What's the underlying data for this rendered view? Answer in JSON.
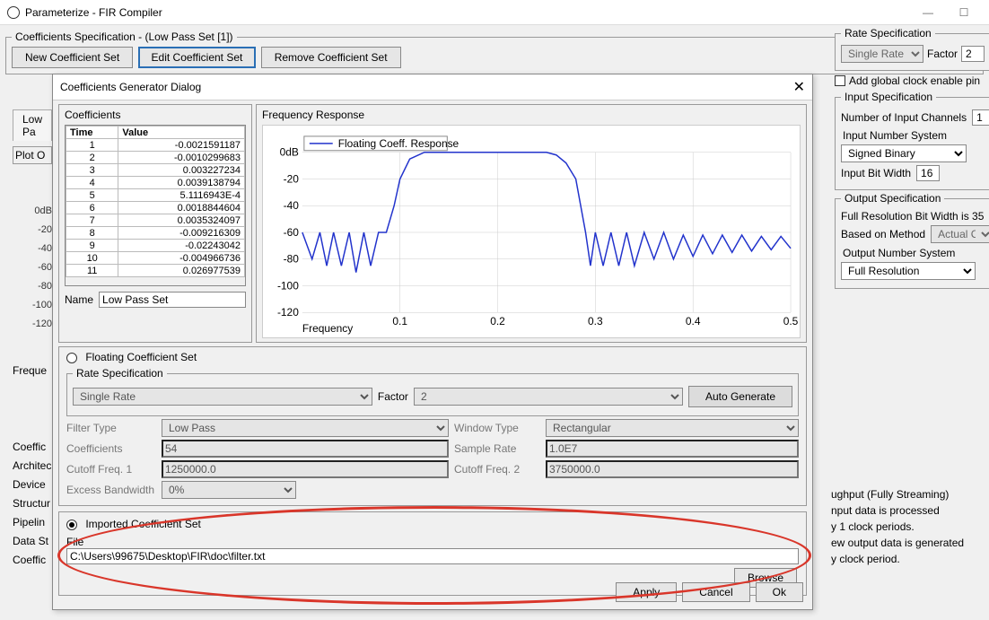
{
  "window": {
    "title": "Parameterize - FIR Compiler"
  },
  "coeffs_spec": {
    "legend": "Coefficients Specification - (Low Pass Set [1])",
    "new_btn": "New Coefficient Set",
    "edit_btn": "Edit Coefficient Set",
    "remove_btn": "Remove Coefficient Set"
  },
  "left_peek": {
    "tab": "Low Pa",
    "plot_legend": "Plot O",
    "yticks": [
      "0dB",
      "-20",
      "-40",
      "-60",
      "-80",
      "-100",
      "-120"
    ],
    "freq_label": "Freque",
    "side_list": [
      "Coeffic",
      "Architec",
      "Device",
      "Structur",
      "Pipelin",
      "Data St",
      "Coeffic"
    ]
  },
  "dialog": {
    "title": "Coefficients Generator Dialog",
    "coeff_legend": "Coefficients",
    "th_time": "Time",
    "th_value": "Value",
    "rows": [
      {
        "t": "1",
        "v": "-0.0021591187"
      },
      {
        "t": "2",
        "v": "-0.0010299683"
      },
      {
        "t": "3",
        "v": "0.003227234"
      },
      {
        "t": "4",
        "v": "0.0039138794"
      },
      {
        "t": "5",
        "v": "5.1116943E-4"
      },
      {
        "t": "6",
        "v": "0.0018844604"
      },
      {
        "t": "7",
        "v": "0.0035324097"
      },
      {
        "t": "8",
        "v": "-0.009216309"
      },
      {
        "t": "9",
        "v": "-0.02243042"
      },
      {
        "t": "10",
        "v": "-0.004966736"
      },
      {
        "t": "11",
        "v": "0.026977539"
      }
    ],
    "name_label": "Name",
    "name_value": "Low Pass Set",
    "freq_legend": "Frequency Response",
    "chart_legend": "Floating Coeff. Response",
    "x_label": "Frequency",
    "x_ticks": [
      "0.1",
      "0.2",
      "0.3",
      "0.4",
      "0.5"
    ],
    "y_ticks": [
      "0dB",
      "-20",
      "-40",
      "-60",
      "-80",
      "-100",
      "-120"
    ],
    "floating_radio": "Floating Coefficient Set",
    "rate_legend": "Rate Specification",
    "rate_value": "Single Rate",
    "factor_label": "Factor",
    "factor_value": "2",
    "auto_btn": "Auto Generate",
    "filter_type_l": "Filter Type",
    "filter_type_v": "Low Pass",
    "window_type_l": "Window Type",
    "window_type_v": "Rectangular",
    "coeffs_l": "Coefficients",
    "coeffs_v": "54",
    "sample_l": "Sample Rate",
    "sample_v": "1.0E7",
    "cut1_l": "Cutoff Freq. 1",
    "cut1_v": "1250000.0",
    "cut2_l": "Cutoff Freq. 2",
    "cut2_v": "3750000.0",
    "excess_l": "Excess Bandwidth",
    "excess_v": "0%",
    "imported_radio": "Imported Coefficient Set",
    "file_l": "File",
    "file_v": "C:\\Users\\99675\\Desktop\\FIR\\doc\\filter.txt",
    "browse": "Browse",
    "apply": "Apply",
    "cancel": "Cancel",
    "ok": "Ok"
  },
  "right": {
    "rate_legend": "Rate Specification",
    "rate_value": "Single Rate",
    "factor_l": "Factor",
    "factor_v": "2",
    "global_clk": "Add global clock enable pin",
    "input_legend": "Input Specification",
    "num_ch_l": "Number of Input Channels",
    "num_ch_v": "1",
    "in_num_sys_l": "Input Number System",
    "in_num_sys_v": "Signed Binary",
    "in_bit_l": "Input Bit Width",
    "in_bit_v": "16",
    "out_legend": "Output Specification",
    "full_res": "Full Resolution Bit Width is 35",
    "based_l": "Based on Method",
    "based_v": "Actual Coeffi",
    "out_num_sys_l": "Output Number System",
    "out_num_sys_v": "Full Resolution",
    "throughput": "ughput (Fully Streaming)",
    "info1a": "nput data is processed",
    "info1b": "y 1 clock periods.",
    "info2a": "ew output data is generated",
    "info2b": "y clock period."
  },
  "chart_data": {
    "type": "line",
    "title": "Frequency Response",
    "xlabel": "Frequency",
    "ylabel": "dB",
    "xlim": [
      0,
      0.5
    ],
    "ylim": [
      -120,
      0
    ],
    "legend": [
      "Floating Coeff. Response"
    ],
    "series": [
      {
        "name": "Floating Coeff. Response",
        "x": [
          0.0,
          0.01,
          0.018,
          0.025,
          0.032,
          0.04,
          0.048,
          0.055,
          0.063,
          0.07,
          0.078,
          0.086,
          0.094,
          0.1,
          0.11,
          0.125,
          0.15,
          0.18,
          0.22,
          0.25,
          0.26,
          0.27,
          0.28,
          0.285,
          0.29,
          0.295,
          0.3,
          0.308,
          0.316,
          0.324,
          0.332,
          0.34,
          0.35,
          0.36,
          0.37,
          0.38,
          0.39,
          0.4,
          0.41,
          0.42,
          0.43,
          0.44,
          0.45,
          0.46,
          0.47,
          0.48,
          0.49,
          0.5
        ],
        "y": [
          -60,
          -80,
          -60,
          -85,
          -60,
          -85,
          -60,
          -90,
          -60,
          -85,
          -60,
          -60,
          -40,
          -20,
          -5,
          0,
          0,
          0,
          0,
          0,
          -2,
          -8,
          -20,
          -40,
          -60,
          -85,
          -60,
          -85,
          -60,
          -85,
          -60,
          -85,
          -60,
          -80,
          -60,
          -80,
          -62,
          -78,
          -62,
          -76,
          -62,
          -75,
          -62,
          -74,
          -63,
          -73,
          -63,
          -72
        ]
      }
    ]
  }
}
